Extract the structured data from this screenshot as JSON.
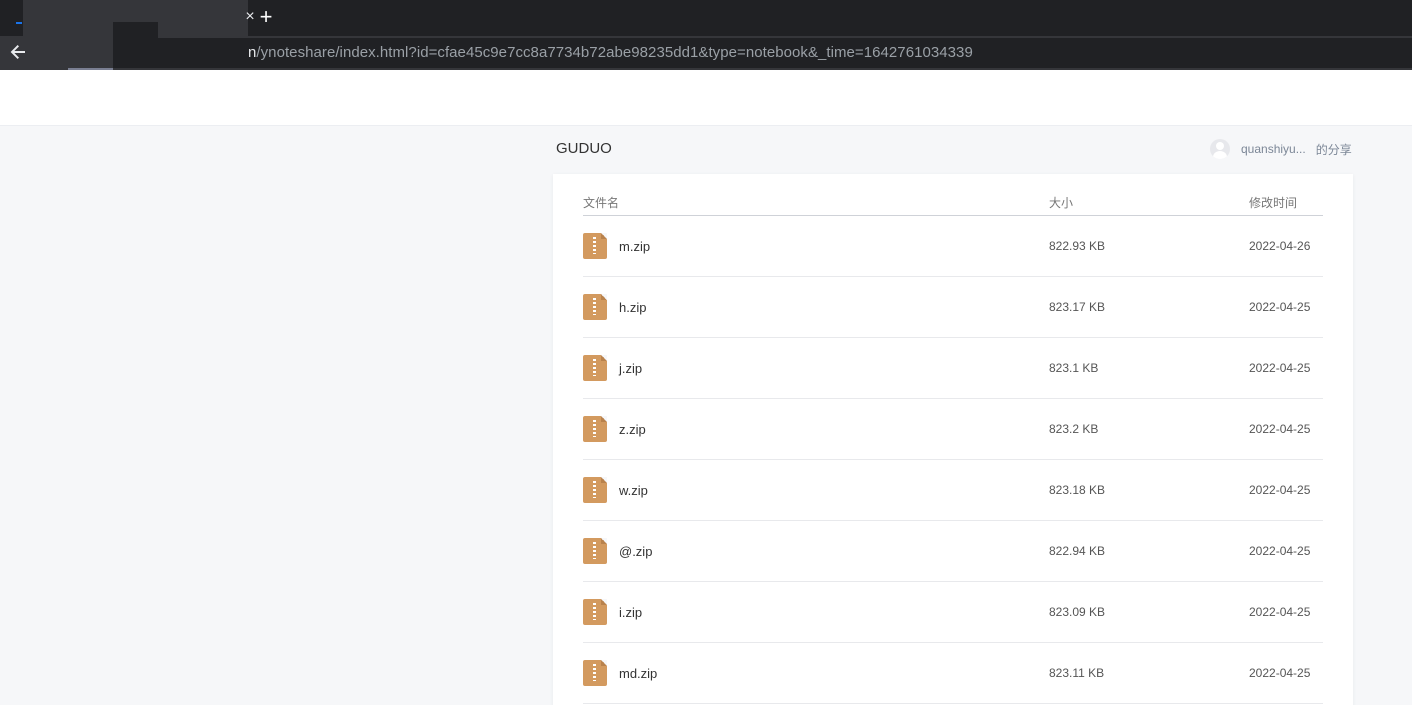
{
  "browser": {
    "tab_close_glyph": "×",
    "new_tab_glyph": "+",
    "url_host_tail": "n",
    "url_path": "/ynoteshare/index.html?id=cfae45c9e7cc8a7734b72abe98235dd1&type=notebook&_time=1642761034339"
  },
  "notebook": {
    "title": "GUDUO",
    "owner": "quanshiyu...",
    "share_suffix": "的分享"
  },
  "table": {
    "headers": {
      "name": "文件名",
      "size": "大小",
      "time": "修改时间"
    },
    "rows": [
      {
        "name": "m.zip",
        "size": "822.93 KB",
        "time": "2022-04-26"
      },
      {
        "name": "h.zip",
        "size": "823.17 KB",
        "time": "2022-04-25"
      },
      {
        "name": "j.zip",
        "size": "823.1 KB",
        "time": "2022-04-25"
      },
      {
        "name": "z.zip",
        "size": "823.2 KB",
        "time": "2022-04-25"
      },
      {
        "name": "w.zip",
        "size": "823.18 KB",
        "time": "2022-04-25"
      },
      {
        "name": "@.zip",
        "size": "822.94 KB",
        "time": "2022-04-25"
      },
      {
        "name": "i.zip",
        "size": "823.09 KB",
        "time": "2022-04-25"
      },
      {
        "name": "md.zip",
        "size": "823.11 KB",
        "time": "2022-04-25"
      }
    ]
  },
  "icons": {
    "file": "zip-file-icon",
    "back": "back-arrow-icon",
    "avatar": "user-avatar-icon"
  },
  "colors": {
    "zip_icon": "#d39a5f",
    "page_bg": "#f6f7f9",
    "chrome_dark": "#202124"
  }
}
